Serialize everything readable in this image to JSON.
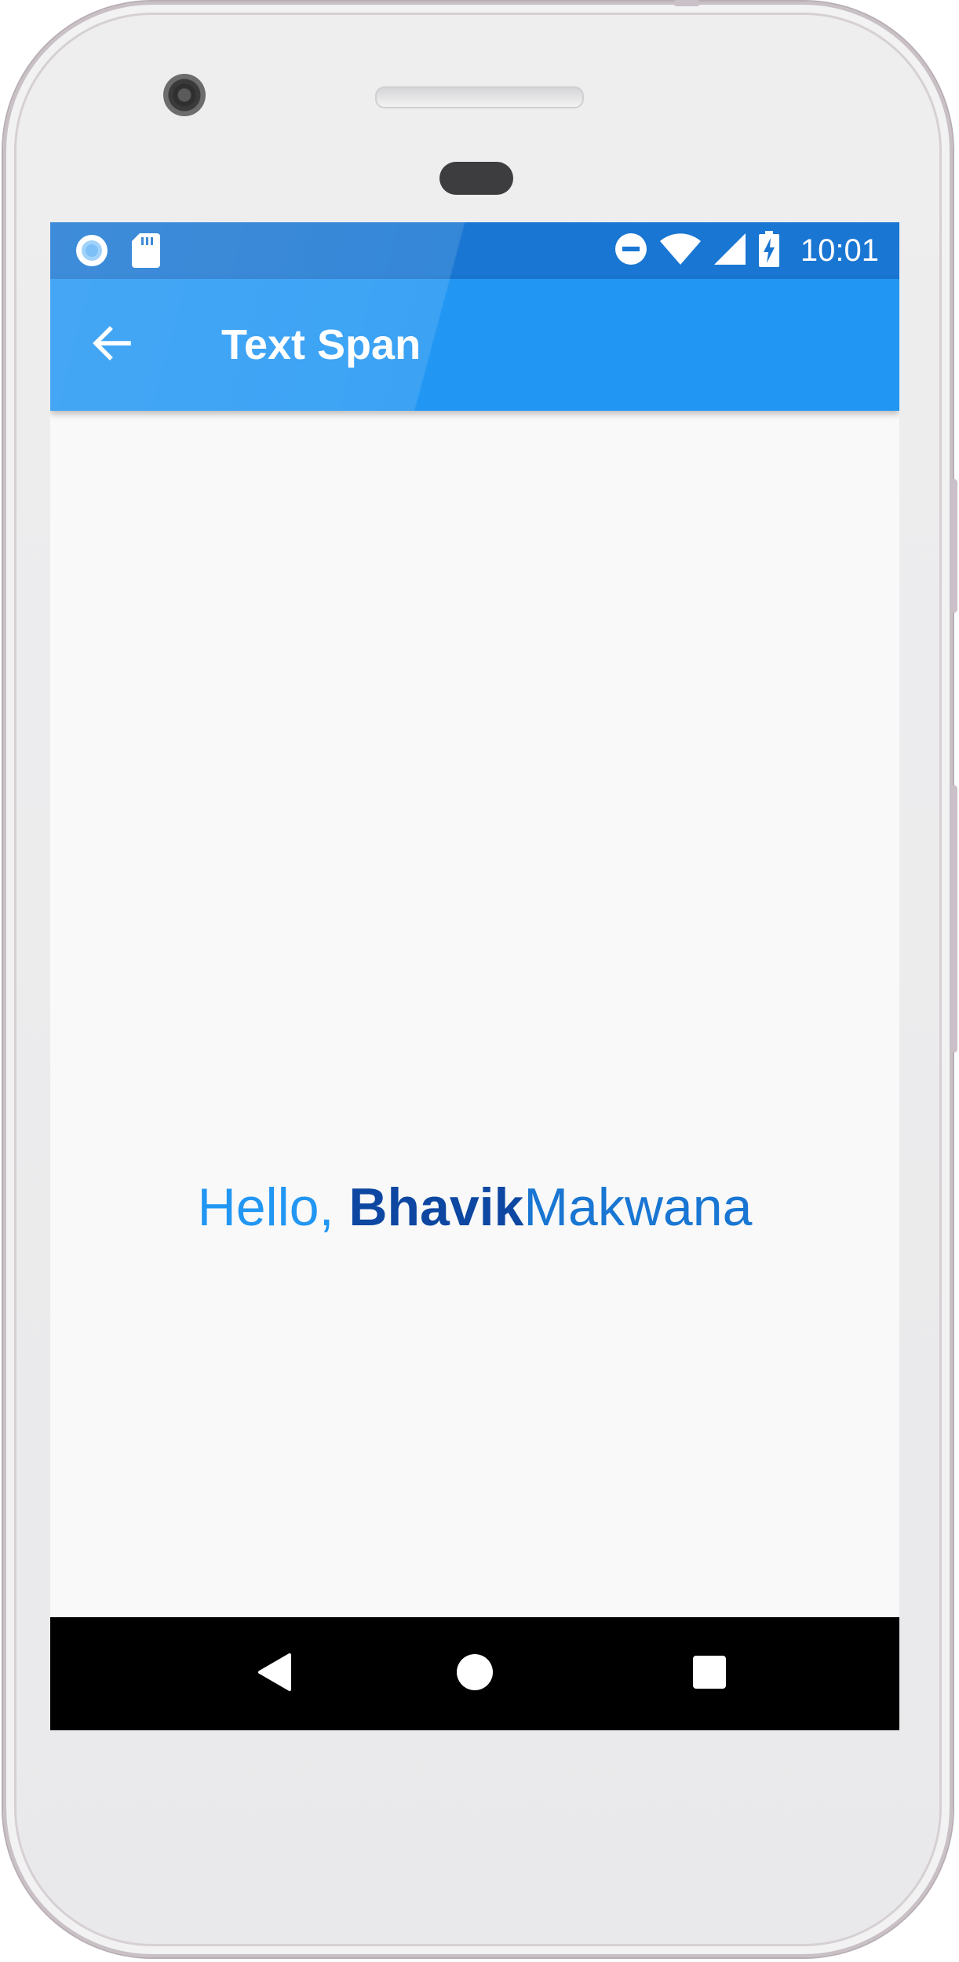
{
  "status_bar": {
    "time": "10:01",
    "left_icons": [
      "notification-circle-icon",
      "sd-card-icon"
    ],
    "right_icons": [
      "do-not-disturb-icon",
      "wifi-icon",
      "cell-signal-icon",
      "battery-charging-icon"
    ]
  },
  "app_bar": {
    "title": "Text Span",
    "back_icon": "arrow-back-icon",
    "color": "#2196f3",
    "status_color": "#1976d2"
  },
  "content": {
    "greeting": "Hello, ",
    "first_name": "Bhavik",
    "last_name": "Makwana",
    "colors": {
      "greeting": "#2196f3",
      "first_name": "#0d47a1",
      "last_name": "#1976d2"
    }
  },
  "nav_bar": {
    "buttons": [
      "back-triangle-icon",
      "home-circle-icon",
      "recents-square-icon"
    ]
  }
}
